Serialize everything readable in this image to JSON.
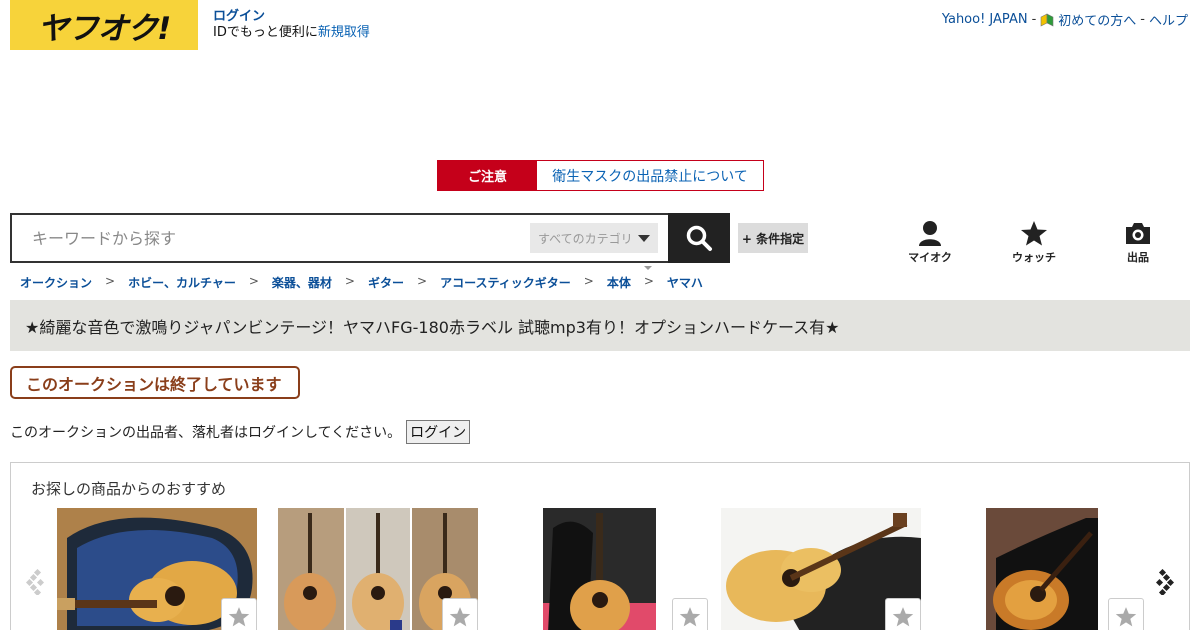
{
  "header": {
    "logo_text": "ヤフオク!",
    "login_label": "ログイン",
    "login_sub_text": "IDでもっと便利に",
    "register_link": "新規取得",
    "top_links": {
      "yahoo_japan": "Yahoo! JAPAN",
      "beginners": "初めての方へ",
      "help": "ヘルプ",
      "separator": "-"
    }
  },
  "notice": {
    "label": "ご注意",
    "link_text": "衛生マスクの出品禁止について"
  },
  "search": {
    "placeholder": "キーワードから探す",
    "category_select": "すべてのカテゴリ",
    "conditions_button": "+ 条件指定"
  },
  "nav_icons": [
    {
      "label": "マイオク",
      "icon": "person-icon"
    },
    {
      "label": "ウォッチ",
      "icon": "star-icon"
    },
    {
      "label": "出品",
      "icon": "camera-icon"
    }
  ],
  "breadcrumb": [
    "オークション",
    "ホビー、カルチャー",
    "楽器、器材",
    "ギター",
    "アコースティックギター",
    "本体",
    "ヤマハ"
  ],
  "breadcrumb_separator": ">",
  "auction": {
    "title": "★綺麗な音色で激鳴りジャパンビンテージ！ヤマハFG-180赤ラベル 試聴mp3有り！オプションハードケース有★",
    "status_badge": "このオークションは終了しています",
    "login_note": "このオークションの出品者、落札者はログインしてください。",
    "login_button": "ログイン"
  },
  "recommendations": {
    "title": "お探しの商品からのおすすめ",
    "items": [
      {
        "name": "guitar-in-blue-case"
      },
      {
        "name": "three-guitars-lineup"
      },
      {
        "name": "guitar-with-gig-bag"
      },
      {
        "name": "natural-guitar-on-case"
      },
      {
        "name": "sunburst-guitar-in-case"
      }
    ]
  },
  "colors": {
    "logo_yellow": "#f7d33a",
    "notice_red": "#c5001a",
    "link_blue": "#0b4f98",
    "ended_brown": "#8a3e1a",
    "title_bar_gray": "#e3e3df"
  }
}
